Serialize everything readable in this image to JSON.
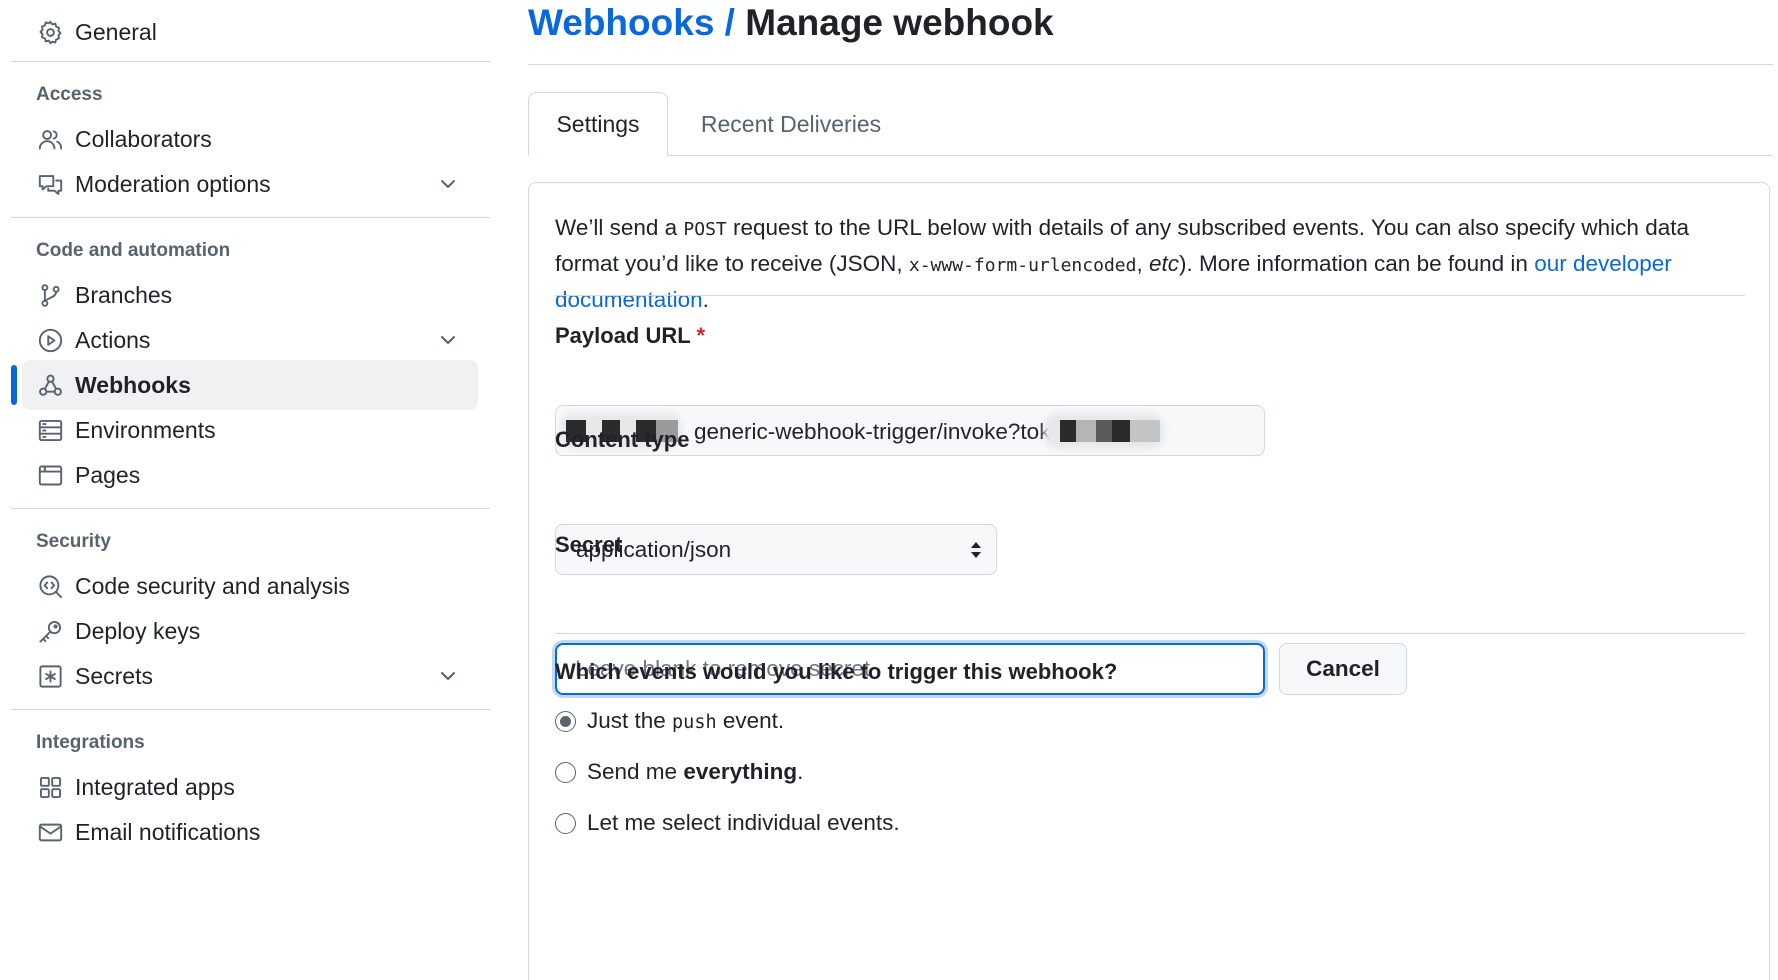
{
  "sidebar": {
    "general": {
      "label": "General",
      "icon": "gear-icon"
    },
    "sections": [
      {
        "heading": "Access",
        "items": [
          {
            "label": "Collaborators",
            "icon": "people-icon"
          },
          {
            "label": "Moderation options",
            "icon": "comment-discussion-icon",
            "expandable": true
          }
        ]
      },
      {
        "heading": "Code and automation",
        "items": [
          {
            "label": "Branches",
            "icon": "git-branch-icon"
          },
          {
            "label": "Actions",
            "icon": "play-icon",
            "expandable": true
          },
          {
            "label": "Webhooks",
            "icon": "webhook-icon",
            "active": true
          },
          {
            "label": "Environments",
            "icon": "server-icon"
          },
          {
            "label": "Pages",
            "icon": "browser-icon"
          }
        ]
      },
      {
        "heading": "Security",
        "items": [
          {
            "label": "Code security and analysis",
            "icon": "codescan-icon"
          },
          {
            "label": "Deploy keys",
            "icon": "key-icon"
          },
          {
            "label": "Secrets",
            "icon": "key-asterisk-icon",
            "expandable": true
          }
        ]
      },
      {
        "heading": "Integrations",
        "items": [
          {
            "label": "Integrated apps",
            "icon": "apps-icon"
          },
          {
            "label": "Email notifications",
            "icon": "mail-icon"
          }
        ]
      }
    ]
  },
  "header": {
    "breadcrumb": "Webhooks",
    "separator": " / ",
    "title": "Manage webhook"
  },
  "tabs": [
    {
      "label": "Settings",
      "active": true
    },
    {
      "label": "Recent Deliveries",
      "active": false
    }
  ],
  "intro": {
    "part1": "We’ll send a ",
    "code1": "POST",
    "part2": " request to the URL below with details of any subscribed events. You can also specify which data format you’d like to receive (JSON, ",
    "code2": "x-www-form-urlencoded",
    "part3": ", ",
    "italic": "etc",
    "part4": "). More information can be found in ",
    "link": "our developer documentation",
    "part5": "."
  },
  "payload_url": {
    "label": "Payload URL",
    "required_mark": "*",
    "visible_value": "generic-webhook-trigger/invoke?token="
  },
  "content_type": {
    "label": "Content type",
    "selected": "application/json"
  },
  "secret": {
    "label": "Secret",
    "placeholder": "Leave blank to remove secret",
    "cancel_label": "Cancel"
  },
  "events": {
    "question": "Which events would you like to trigger this webhook?",
    "options": [
      {
        "pre": "Just the ",
        "code": "push",
        "post": " event.",
        "checked": true
      },
      {
        "pre": "Send me ",
        "bold": "everything",
        "post": ".",
        "checked": false
      },
      {
        "pre": "Let me select individual events.",
        "checked": false
      }
    ]
  },
  "colors": {
    "accent": "#0969da",
    "text": "#1f2328",
    "muted": "#59636e",
    "border": "#d1d9e0",
    "required": "#d1242f",
    "active_bg": "#eff1f3"
  }
}
